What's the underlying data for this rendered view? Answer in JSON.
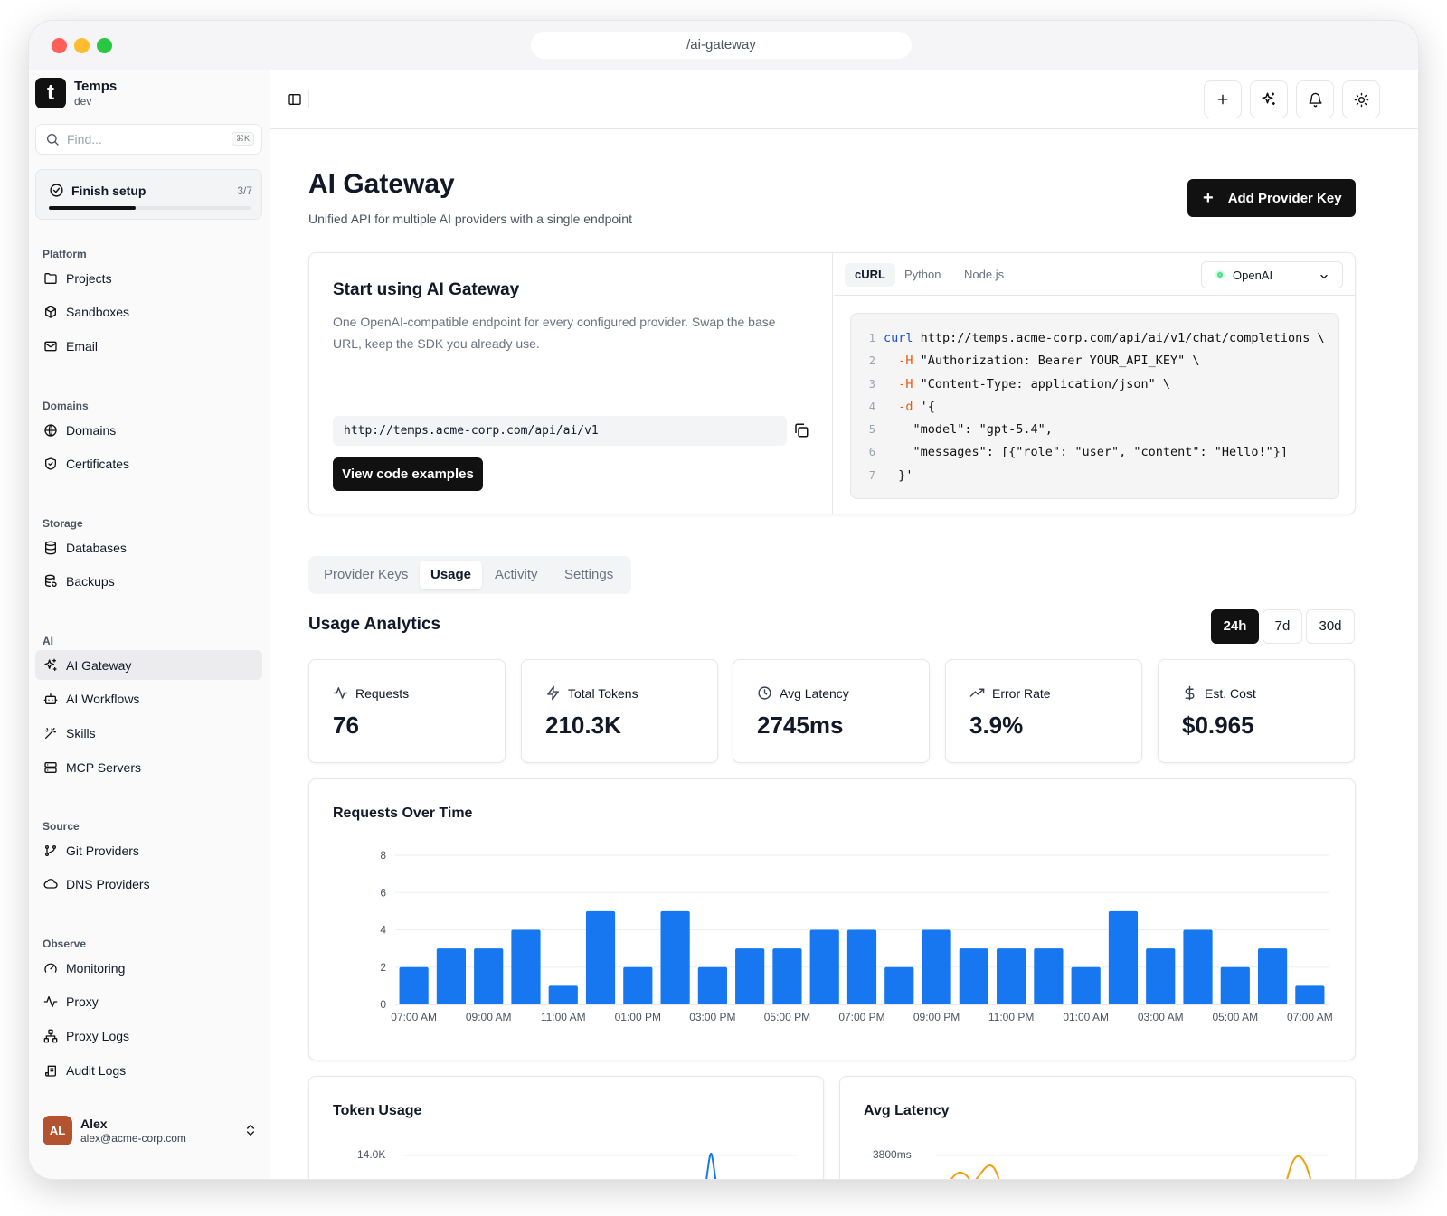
{
  "browser": {
    "url": "/ai-gateway"
  },
  "sidebar": {
    "brand": {
      "name": "Temps",
      "env": "dev",
      "logo": "t"
    },
    "search": {
      "placeholder": "Find...",
      "shortcut": "⌘K"
    },
    "setup": {
      "label": "Finish setup",
      "count": "3/7",
      "progress": 0.4286
    },
    "sections": [
      {
        "label": "Platform",
        "items": [
          {
            "label": "Projects",
            "icon": "folder-icon"
          },
          {
            "label": "Sandboxes",
            "icon": "box-icon"
          },
          {
            "label": "Email",
            "icon": "mail-icon"
          }
        ]
      },
      {
        "label": "Domains",
        "items": [
          {
            "label": "Domains",
            "icon": "globe-icon"
          },
          {
            "label": "Certificates",
            "icon": "shield-icon"
          }
        ]
      },
      {
        "label": "Storage",
        "items": [
          {
            "label": "Databases",
            "icon": "database-icon"
          },
          {
            "label": "Backups",
            "icon": "backup-icon"
          }
        ]
      },
      {
        "label": "AI",
        "items": [
          {
            "label": "AI Gateway",
            "icon": "sparkles-icon",
            "active": true
          },
          {
            "label": "AI Workflows",
            "icon": "bot-icon"
          },
          {
            "label": "Skills",
            "icon": "wand-icon"
          },
          {
            "label": "MCP Servers",
            "icon": "server-icon"
          }
        ]
      },
      {
        "label": "Source",
        "items": [
          {
            "label": "Git Providers",
            "icon": "git-branch-icon"
          },
          {
            "label": "DNS Providers",
            "icon": "cloud-icon"
          }
        ]
      },
      {
        "label": "Observe",
        "items": [
          {
            "label": "Monitoring",
            "icon": "gauge-icon"
          },
          {
            "label": "Proxy",
            "icon": "activity-icon"
          },
          {
            "label": "Proxy Logs",
            "icon": "network-icon"
          },
          {
            "label": "Audit Logs",
            "icon": "scroll-icon"
          }
        ]
      }
    ],
    "user": {
      "initials": "AL",
      "name": "Alex",
      "email": "alex@acme-corp.com"
    }
  },
  "header": {
    "title": "AI Gateway",
    "subtitle": "Unified API for multiple AI providers with a single endpoint",
    "add_button": "Add Provider Key"
  },
  "start_card": {
    "title": "Start using AI Gateway",
    "description": "One OpenAI-compatible endpoint for every configured provider. Swap the base URL, keep the SDK you already use.",
    "endpoint": "http://temps.acme-corp.com/api/ai/v1",
    "button": "View code examples",
    "code_tabs": [
      "cURL",
      "Python",
      "Node.js"
    ],
    "active_code_tab": "cURL",
    "provider": "OpenAI",
    "code_lines": [
      {
        "n": "1",
        "parts": [
          [
            "kw",
            "curl"
          ],
          [
            "",
            " http://temps.acme-corp.com/api/ai/v1/chat/completions \\"
          ]
        ]
      },
      {
        "n": "2",
        "parts": [
          [
            "",
            "  "
          ],
          [
            "flag",
            "-H"
          ],
          [
            "",
            " \"Authorization: Bearer YOUR_API_KEY\" \\"
          ]
        ]
      },
      {
        "n": "3",
        "parts": [
          [
            "",
            "  "
          ],
          [
            "flag",
            "-H"
          ],
          [
            "",
            " \"Content-Type: application/json\" \\"
          ]
        ]
      },
      {
        "n": "4",
        "parts": [
          [
            "",
            "  "
          ],
          [
            "flag",
            "-d"
          ],
          [
            "",
            " '{"
          ]
        ]
      },
      {
        "n": "5",
        "parts": [
          [
            "",
            "    \"model\": \"gpt-5.4\","
          ]
        ]
      },
      {
        "n": "6",
        "parts": [
          [
            "",
            "    \"messages\": [{\"role\": \"user\", \"content\": \"Hello!\"}]"
          ]
        ]
      },
      {
        "n": "7",
        "parts": [
          [
            "",
            "  }'"
          ]
        ]
      }
    ]
  },
  "tabs": {
    "items": [
      "Provider Keys",
      "Usage",
      "Activity",
      "Settings"
    ],
    "active": "Usage"
  },
  "analytics": {
    "title": "Usage Analytics",
    "ranges": [
      "24h",
      "7d",
      "30d"
    ],
    "active_range": "24h",
    "stats": [
      {
        "label": "Requests",
        "value": "76",
        "icon": "activity-icon"
      },
      {
        "label": "Total Tokens",
        "value": "210.3K",
        "icon": "zap-icon"
      },
      {
        "label": "Avg Latency",
        "value": "2745ms",
        "icon": "clock-icon"
      },
      {
        "label": "Error Rate",
        "value": "3.9%",
        "icon": "trending-up-icon"
      },
      {
        "label": "Est. Cost",
        "value": "$0.965",
        "icon": "dollar-icon"
      }
    ]
  },
  "chart_data": [
    {
      "type": "bar",
      "title": "Requests Over Time",
      "x_tick_labels": [
        "07:00 AM",
        "09:00 AM",
        "11:00 AM",
        "01:00 PM",
        "03:00 PM",
        "05:00 PM",
        "07:00 PM",
        "09:00 PM",
        "11:00 PM",
        "01:00 AM",
        "03:00 AM",
        "05:00 AM",
        "07:00 AM"
      ],
      "y_ticks": [
        0,
        2,
        4,
        6,
        8
      ],
      "ylim": [
        0,
        8
      ],
      "values": [
        2,
        3,
        3,
        4,
        1,
        5,
        2,
        5,
        2,
        3,
        3,
        4,
        4,
        2,
        4,
        3,
        3,
        3,
        2,
        5,
        3,
        4,
        2,
        3,
        1
      ],
      "color": "#1677f0",
      "grid": true
    },
    {
      "type": "line",
      "title": "Token Usage",
      "y_ticks_visible": [
        "14.0K"
      ],
      "color": "#1677f0"
    },
    {
      "type": "line",
      "title": "Avg Latency",
      "y_ticks_visible": [
        "3800ms"
      ],
      "color": "#f59e0b"
    }
  ]
}
